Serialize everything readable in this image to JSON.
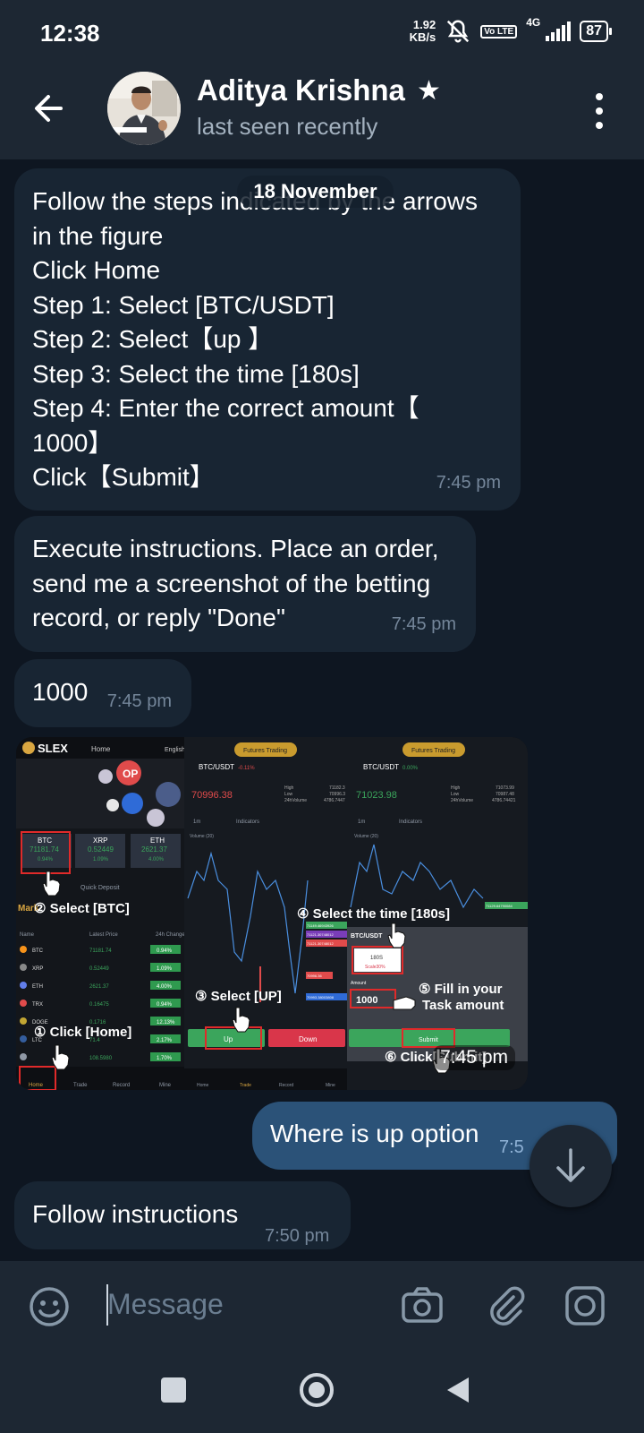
{
  "status_bar": {
    "time": "12:38",
    "speed_value": "1.92",
    "speed_unit": "KB/s",
    "volte": "Vo LTE",
    "network": "4G",
    "battery": "87"
  },
  "header": {
    "contact_name": "Aditya Krishna",
    "status": "last seen recently"
  },
  "chat": {
    "date_chip": "18 November",
    "messages": [
      {
        "lines": [
          "Follow the steps indicated by the arrows",
          "in the figure",
          "Click Home",
          "Step 1: Select [BTC/USDT]",
          "Step 2: Select【up 】",
          "Step 3: Select the time [180s]",
          "Step 4: Enter the correct amount【",
          "1000】",
          "Click【Submit】"
        ],
        "time": "7:45 pm"
      },
      {
        "lines": [
          "Execute instructions. Place an order,",
          "send me a screenshot of the betting",
          "record, or reply \"Done\""
        ],
        "time": "7:45 pm"
      },
      {
        "text": "1000",
        "time": "7:45 pm"
      },
      {
        "image_time": "7:45 pm"
      },
      {
        "text": "Where is up option",
        "time": "7:5",
        "outgoing": true
      },
      {
        "text": "Follow instructions",
        "time": "7:50 pm"
      }
    ]
  },
  "screenshot_image": {
    "panel1": {
      "brand": "SLEX",
      "nav": "Home",
      "lang": "English",
      "badge": "OP",
      "tickers": [
        {
          "symbol": "BTC",
          "price": "71181.74",
          "change": "0.94%"
        },
        {
          "symbol": "XRP",
          "price": "0.52449",
          "change": "1.09%"
        },
        {
          "symbol": "ETH",
          "price": "2621.37",
          "change": "4.00%"
        }
      ],
      "quick_deposit": "Quick Deposit",
      "market_title": "Mark",
      "columns": [
        "Name",
        "Latest Price",
        "24h Change"
      ],
      "rows": [
        {
          "name": "BTC",
          "price": "71181.74",
          "change": "0.94%"
        },
        {
          "name": "XRP",
          "price": "0.52449",
          "change": "1.09%"
        },
        {
          "name": "ETH",
          "price": "2621.37",
          "change": "4.00%"
        },
        {
          "name": "TRX",
          "price": "0.16475",
          "change": "0.94%"
        },
        {
          "name": "DOGE",
          "price": "0.1716",
          "change": "12.13%"
        },
        {
          "name": "LTC",
          "price": "71.4",
          "change": "2.17%"
        },
        {
          "name": "",
          "price": "108.5980",
          "change": "1.70%"
        }
      ],
      "tabs": [
        "Home",
        "Trade",
        "Record",
        "Mine"
      ]
    },
    "panel2": {
      "futures_label": "Futures Trading",
      "pair": "BTC/USDT",
      "pair_change": "-0.11%",
      "price": "70996.38",
      "stats": [
        [
          "High",
          "71182.3"
        ],
        [
          "Low",
          "70996.3"
        ],
        [
          "24hVolume",
          "4786.7447"
        ]
      ],
      "timeframe": "1m",
      "indicators": "Indicators",
      "volume_label": "Volume (20)",
      "up_label": "Up",
      "down_label": "Down",
      "price_levels": [
        "71149.46943926",
        "71121.30748012",
        "71121.30748012",
        "70996.36",
        "70993.38003808"
      ],
      "tabs": [
        "Home",
        "Trade",
        "Record",
        "Mine"
      ]
    },
    "panel3": {
      "futures_label": "Futures Trading",
      "pair": "BTC/USDT",
      "pair_change": "0.00%",
      "price": "71023.98",
      "stats": [
        [
          "High",
          "71073.99"
        ],
        [
          "Low",
          "70987.48"
        ],
        [
          "24hVolume",
          "4786.74421"
        ]
      ],
      "timeframe": "1m",
      "indicators": "Indicators",
      "volume_label": "Volume (20)",
      "pair2": "BTC/USDT",
      "time_value": "180S",
      "time_sub": "Scale30%",
      "amount_label": "Amount",
      "amount_value": "1000",
      "submit_label": "Submit",
      "price_levels": [
        "71129.64790084"
      ]
    },
    "annotations": {
      "step1": "① Click [Home]",
      "step2": "② Select [BTC]",
      "step3": "③ Select [UP]",
      "step4": "④ Select the time [180s]",
      "step5a": "⑤ Fill in your",
      "step5b": "Task amount",
      "step6": "⑥ Click[Submit]"
    }
  },
  "input": {
    "placeholder": "Message"
  },
  "colors": {
    "incoming_bubble": "#182533",
    "outgoing_bubble": "#2b5278",
    "background": "#0e1621",
    "header": "#1d2733",
    "green": "#3ba55c",
    "red": "#d9364a"
  }
}
